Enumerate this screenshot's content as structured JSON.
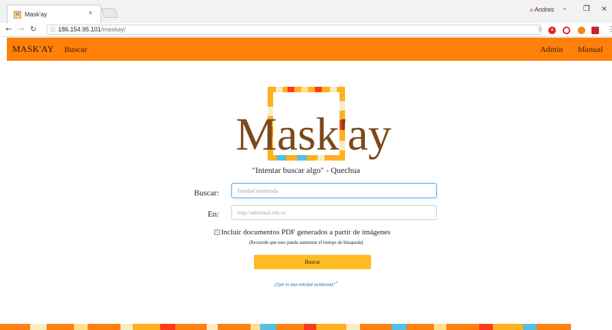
{
  "browser": {
    "tab_title": "Mask'ay",
    "tab_close": "×",
    "user_name": "Andres",
    "url_host": "186.154.95.101",
    "url_path": "/maskay/",
    "window_minimize": "–",
    "window_restore": "❐",
    "window_close": "×"
  },
  "nav": {
    "brand": "MASK'AY",
    "buscar": "Buscar",
    "admin": "Admin",
    "manual": "Manual"
  },
  "logo": {
    "text": "Mask'ay"
  },
  "motto": "\"Intentar buscar algo\" - Quechua",
  "form": {
    "buscar_label": "Buscar:",
    "buscar_placeholder": "Entidad nombrada",
    "en_label": "En:",
    "en_placeholder": "http://udistrital.edu.co",
    "checkbox_label": "Incluir documentos PDF generados a partir de imágenes",
    "checkbox_checked": false,
    "note": "(Recuerde que esto puede aumentar el tiempo de búsqueda)",
    "submit_label": "Buscar",
    "help_link": "¿Qué es una entidad nombrada?"
  },
  "colors": {
    "nav_bg": "#ff8008",
    "button_bg": "#ffbb22",
    "logo_brown": "#7a4a1c",
    "frame_orange": "#ffb020"
  }
}
